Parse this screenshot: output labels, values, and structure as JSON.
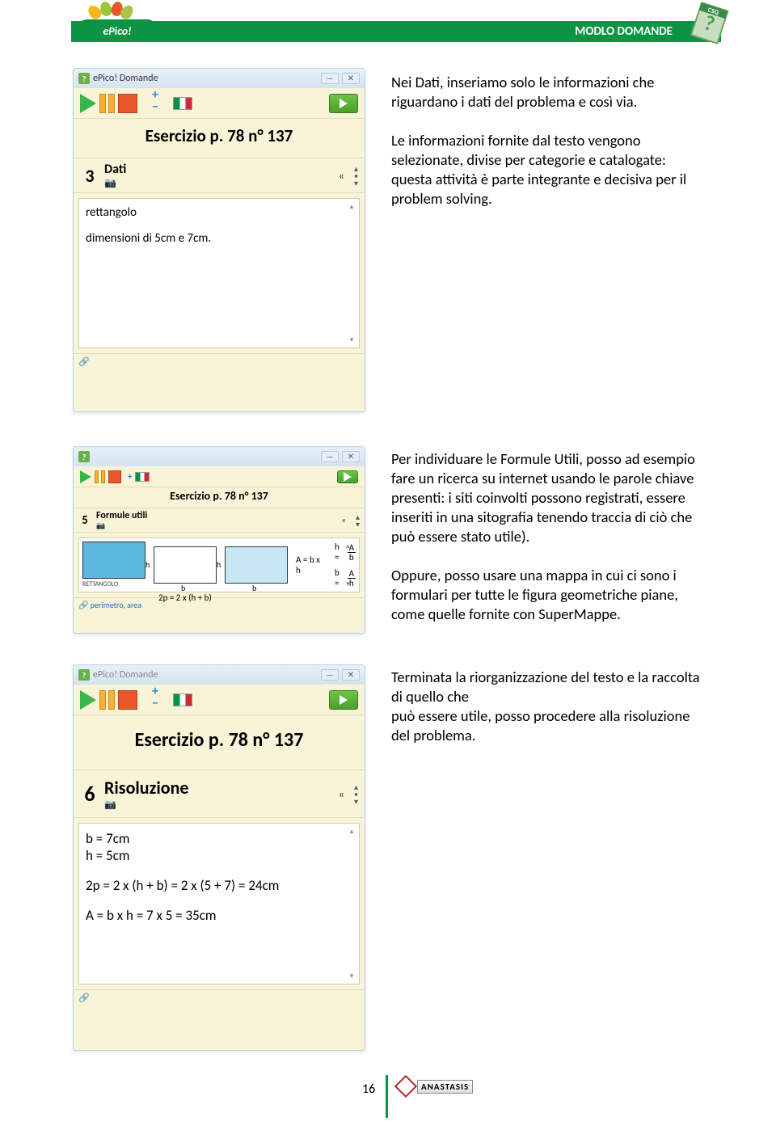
{
  "header": {
    "title": "MODLO DOMANDE",
    "logo_text": "ePico!",
    "csq": "CSQ"
  },
  "win1": {
    "title": "ePico! Domande",
    "exercise": "Esercizio p. 78 n° 137",
    "section_num": "3",
    "section_label": "Dati",
    "text_line1": "rettangolo",
    "text_line2": "dimensioni di 5cm e 7cm.",
    "quote": "«"
  },
  "para1": "Nei Dati, inseriamo solo le informazioni che riguardano i dati del problema e così via.",
  "para1b": "Le informazioni fornite dal testo vengono selezionate, divise per categorie e catalogate: questa attività è parte integrante e decisiva per il problem solving.",
  "win2": {
    "exercise": "Esercizio p. 78 n° 137",
    "section_num": "5",
    "section_label": "Formule utili",
    "rett": "RETTANGOLO",
    "f_perim": "2p = 2 x (h + b)",
    "f_area": "A = b x h",
    "f_h": "h =",
    "f_b": "b =",
    "link": "perimetro, area",
    "quote": "«"
  },
  "para2a": "Per individuare le Formule Utili, posso ad esempio fare un ricerca su internet usando le parole chiave presenti: i siti coinvolti possono registrati, essere inseriti in una sitografia tenendo traccia di ciò che può essere stato utile).",
  "para2b": "Oppure, posso usare una mappa in cui ci sono i formulari per tutte le figura geometriche piane, come quelle fornite con SuperMappe.",
  "win3": {
    "title": "ePico! Domande",
    "exercise": "Esercizio p. 78 n° 137",
    "section_num": "6",
    "section_label": "Risoluzione",
    "line1": "b = 7cm",
    "line2": "h = 5cm",
    "line3": "2p = 2 x (h + b) = 2 x (5 + 7) = 24cm",
    "line4": "A = b x h = 7 x 5 = 35cm",
    "quote": "«"
  },
  "para3a": "Terminata la riorganizzazione del testo e la raccolta di quello che",
  "para3b": "può essere utile, posso procedere alla risoluzione del problema.",
  "footer": {
    "page": "16",
    "brand": "ANASTASIS"
  }
}
